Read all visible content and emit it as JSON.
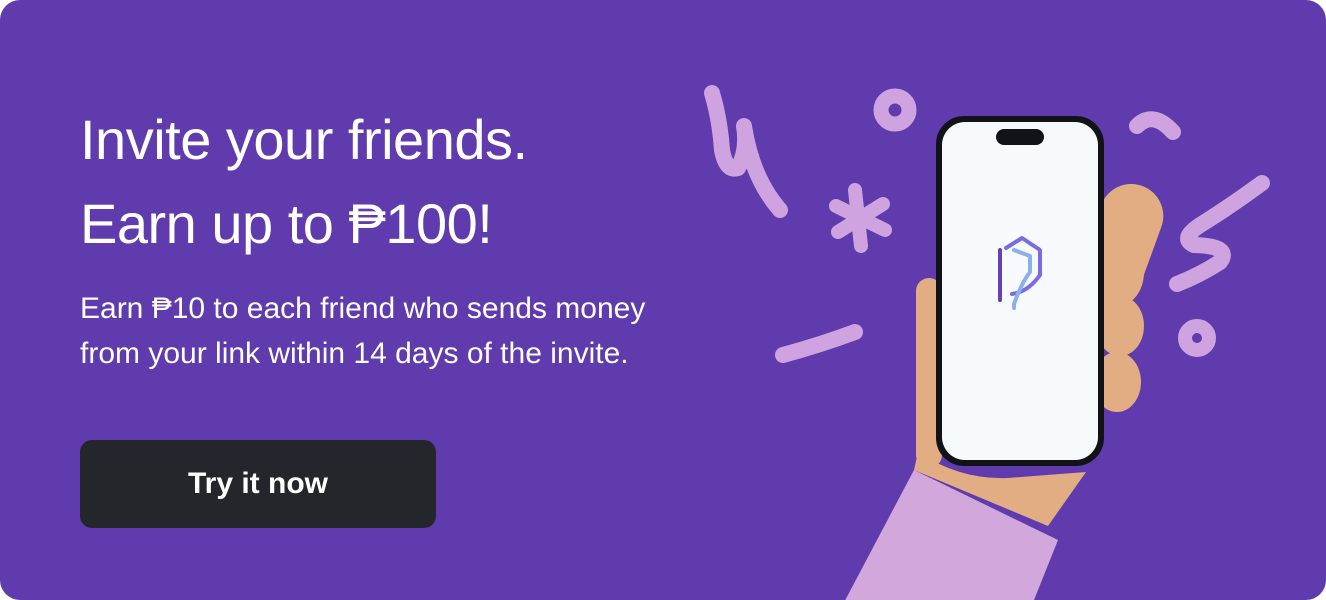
{
  "banner": {
    "headline_line1": "Invite your friends.",
    "headline_line2": "Earn up to ₱100!",
    "subtext_line1": "Earn ₱10 to each friend who sends money",
    "subtext_line2": "from your link within 14 days of the invite.",
    "cta_label": "Try it now"
  },
  "colors": {
    "background": "#5f3bad",
    "button": "#25262b",
    "text": "#ffffff",
    "doodles": "#cfa3e0",
    "skin": "#e2ad82",
    "sleeve": "#d2a7dc",
    "phone_screen": "#f6fafd"
  },
  "illustration": {
    "icons": [
      "hand-holding-phone",
      "app-logo-icon",
      "doodle-squiggles"
    ]
  }
}
